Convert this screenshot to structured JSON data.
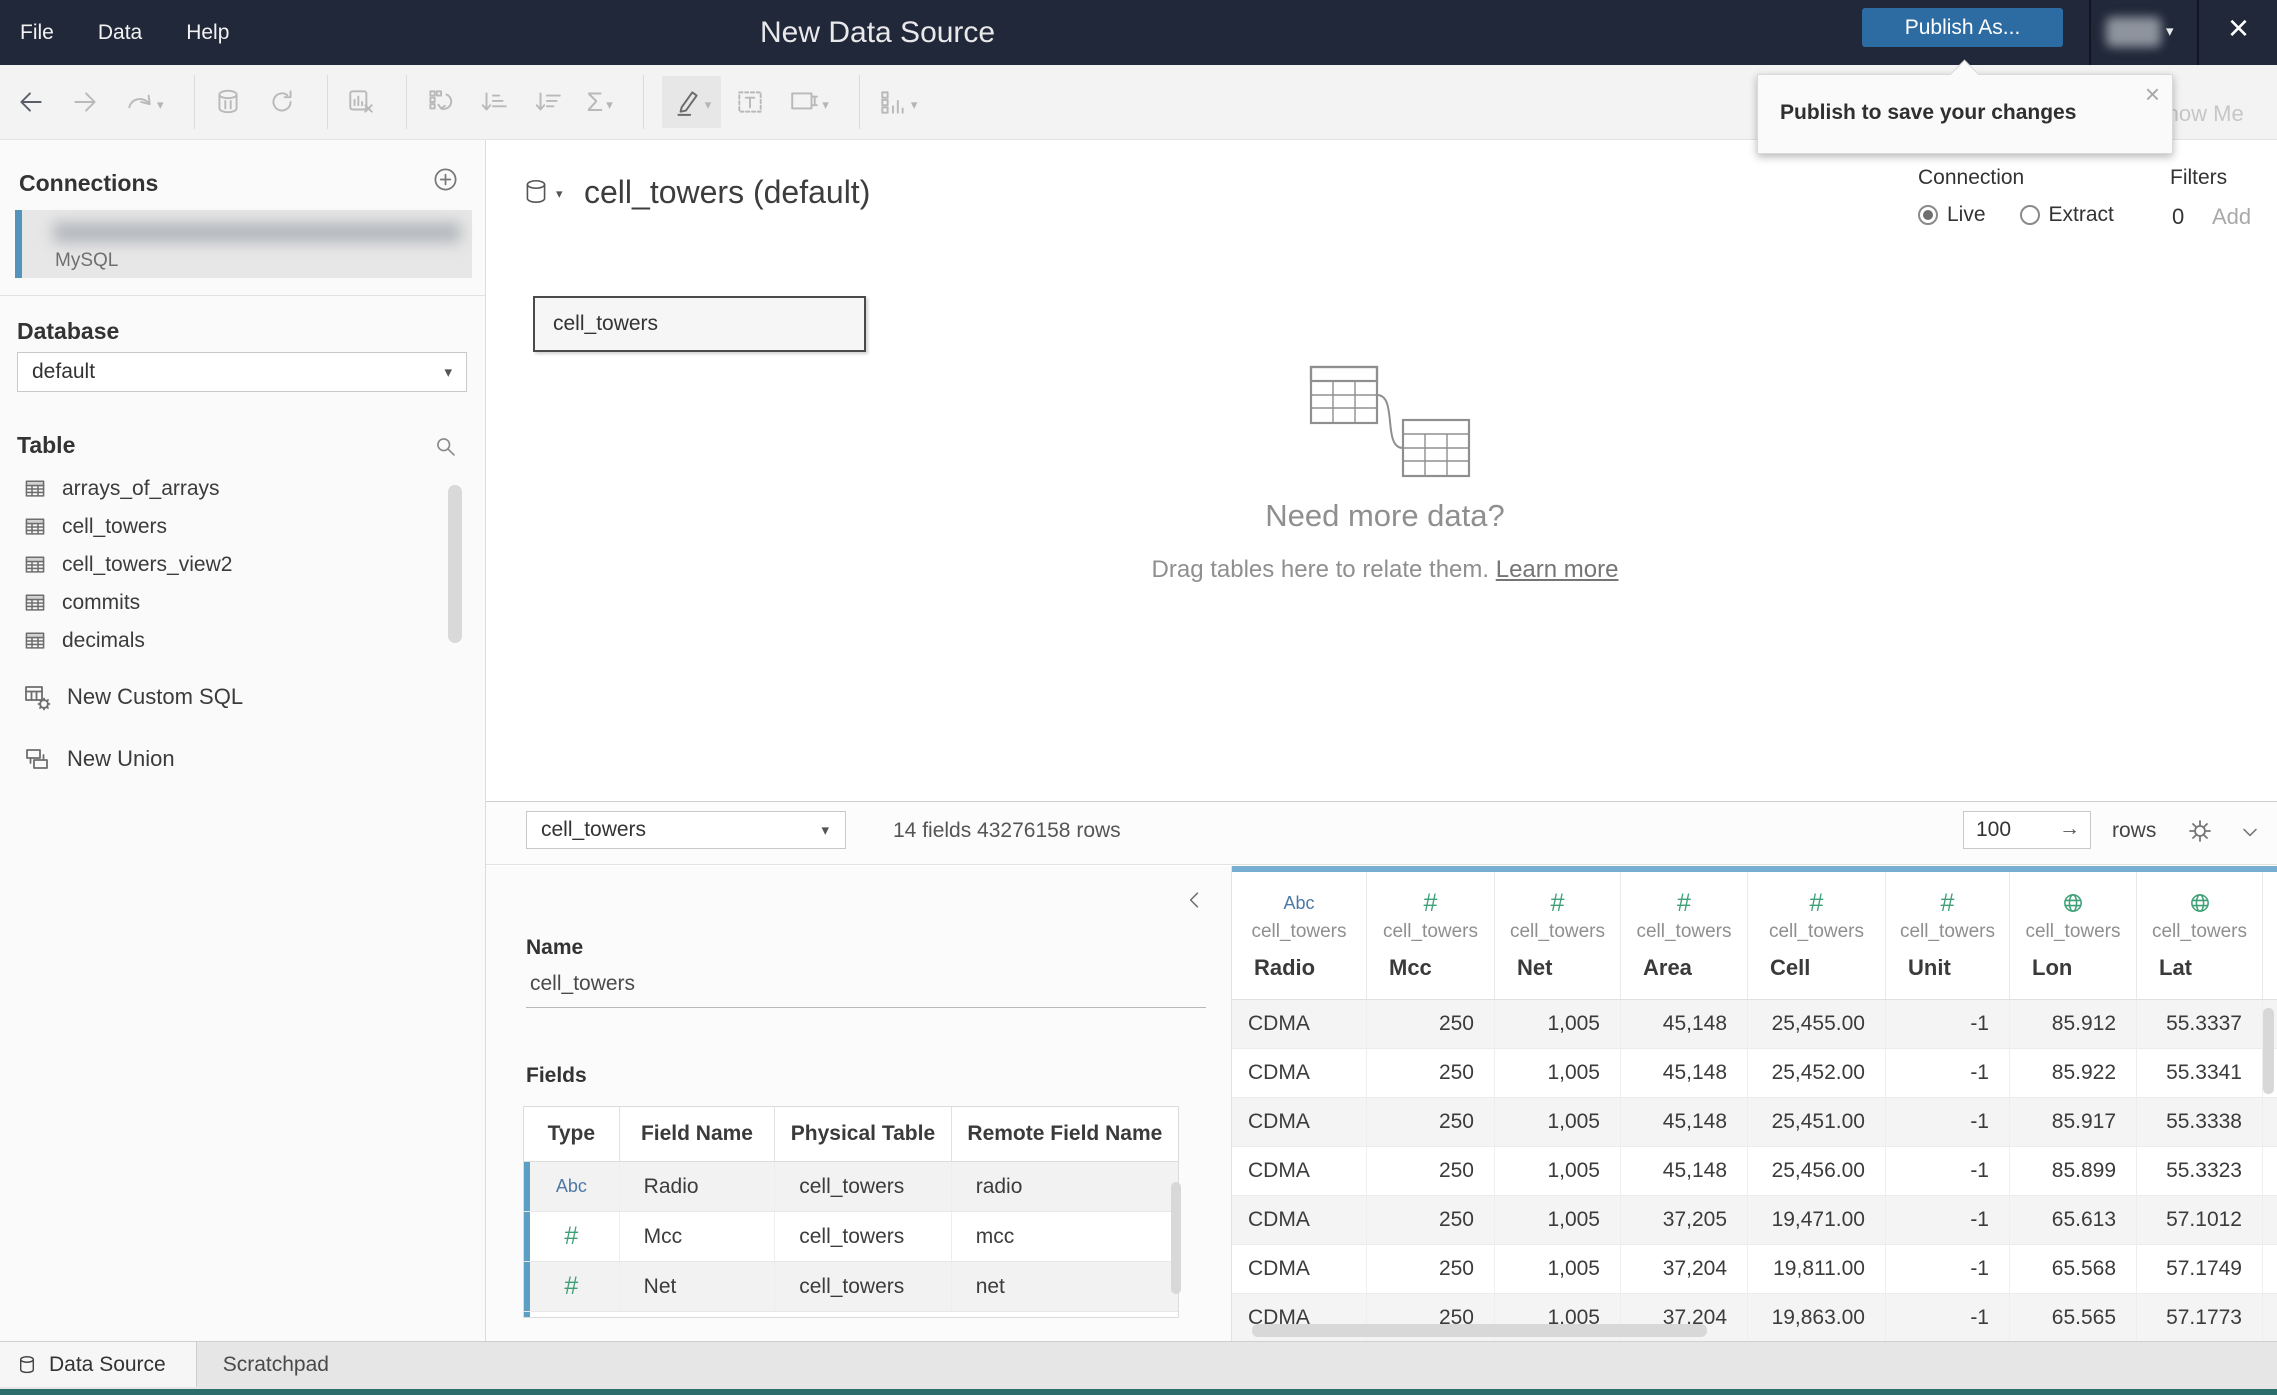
{
  "topbar": {
    "title": "New Data Source",
    "menus": [
      "File",
      "Data",
      "Help"
    ],
    "publish_button": "Publish As...",
    "show_me": "Show Me"
  },
  "tooltip": {
    "text": "Publish to save your changes"
  },
  "toolbar": {
    "groups": [
      [
        {
          "name": "back-icon",
          "tone": "dark"
        },
        {
          "name": "forward-icon",
          "tone": "dim"
        },
        {
          "name": "redo-icon",
          "tone": "dim",
          "caret": true
        }
      ],
      [
        {
          "name": "pause-updates-icon",
          "tone": "dim"
        },
        {
          "name": "refresh-data-source-icon",
          "tone": "dim"
        }
      ],
      [
        {
          "name": "clear-sheet-icon",
          "tone": "dim"
        }
      ],
      [
        {
          "name": "swap-rows-columns-icon",
          "tone": "dim"
        },
        {
          "name": "sort-ascending-icon",
          "tone": "dim"
        },
        {
          "name": "sort-descending-icon",
          "tone": "dim"
        },
        {
          "name": "totals-icon",
          "tone": "dim",
          "caret": true,
          "glyph": "Σ"
        }
      ],
      [
        {
          "name": "highlight-icon",
          "tone": "dark",
          "active": true,
          "caret": true
        },
        {
          "name": "text-label-icon",
          "tone": "dim"
        },
        {
          "name": "fit-icon",
          "tone": "dim",
          "caret": true
        }
      ],
      [
        {
          "name": "show-mark-labels-icon",
          "tone": "dim",
          "caret": true
        }
      ]
    ]
  },
  "sidebar": {
    "connections_title": "Connections",
    "connection": {
      "name_redacted": true,
      "type": "MySQL"
    },
    "database_label": "Database",
    "database_value": "default",
    "table_label": "Table",
    "tables": [
      "arrays_of_arrays",
      "cell_towers",
      "cell_towers_view2",
      "commits",
      "decimals"
    ],
    "actions": [
      {
        "label": "New Custom SQL",
        "icon": "custom-sql-icon"
      },
      {
        "label": "New Union",
        "icon": "union-icon"
      }
    ]
  },
  "canvas": {
    "datasource_title": "cell_towers (default)",
    "connection_label": "Connection",
    "connection_options": [
      {
        "label": "Live",
        "selected": true
      },
      {
        "label": "Extract",
        "selected": false
      }
    ],
    "filters_label": "Filters",
    "filters_count": "0",
    "filters_add": "Add",
    "table_node": "cell_towers",
    "empty_title": "Need more data?",
    "empty_body": "Drag tables here to relate them.",
    "empty_link": "Learn more"
  },
  "preview": {
    "table_selector": "cell_towers",
    "summary": "14 fields 43276158 rows",
    "row_count": "100",
    "rows_label": "rows"
  },
  "metadata": {
    "name_label": "Name",
    "name_value": "cell_towers",
    "fields_label": "Fields",
    "columns": [
      "Type",
      "Field Name",
      "Physical Table",
      "Remote Field Name"
    ],
    "fields": [
      {
        "type": "string",
        "field_name": "Radio",
        "physical_table": "cell_towers",
        "remote_field_name": "radio"
      },
      {
        "type": "number",
        "field_name": "Mcc",
        "physical_table": "cell_towers",
        "remote_field_name": "mcc"
      },
      {
        "type": "number",
        "field_name": "Net",
        "physical_table": "cell_towers",
        "remote_field_name": "net"
      }
    ]
  },
  "grid": {
    "columns": [
      {
        "name": "Radio",
        "table": "cell_towers",
        "type": "string"
      },
      {
        "name": "Mcc",
        "table": "cell_towers",
        "type": "number"
      },
      {
        "name": "Net",
        "table": "cell_towers",
        "type": "number"
      },
      {
        "name": "Area",
        "table": "cell_towers",
        "type": "number"
      },
      {
        "name": "Cell",
        "table": "cell_towers",
        "type": "number"
      },
      {
        "name": "Unit",
        "table": "cell_towers",
        "type": "number"
      },
      {
        "name": "Lon",
        "table": "cell_towers",
        "type": "geographic"
      },
      {
        "name": "Lat",
        "table": "cell_towers",
        "type": "geographic"
      }
    ],
    "rows": [
      [
        "CDMA",
        "250",
        "1,005",
        "45,148",
        "25,455.00",
        "-1",
        "85.912",
        "55.3337"
      ],
      [
        "CDMA",
        "250",
        "1,005",
        "45,148",
        "25,452.00",
        "-1",
        "85.922",
        "55.3341"
      ],
      [
        "CDMA",
        "250",
        "1,005",
        "45,148",
        "25,451.00",
        "-1",
        "85.917",
        "55.3338"
      ],
      [
        "CDMA",
        "250",
        "1,005",
        "45,148",
        "25,456.00",
        "-1",
        "85.899",
        "55.3323"
      ],
      [
        "CDMA",
        "250",
        "1,005",
        "37,205",
        "19,471.00",
        "-1",
        "65.613",
        "57.1012"
      ],
      [
        "CDMA",
        "250",
        "1,005",
        "37,204",
        "19,811.00",
        "-1",
        "65.568",
        "57.1749"
      ],
      [
        "CDMA",
        "250",
        "1,005",
        "37,204",
        "19,863.00",
        "-1",
        "65.565",
        "57.1773"
      ]
    ]
  },
  "footer": {
    "tabs": [
      {
        "label": "Data Source",
        "active": true,
        "icon": "datasource-cylinder-icon"
      },
      {
        "label": "Scratchpad",
        "active": false
      }
    ]
  },
  "colors": {
    "topbar": "#212839",
    "publish_blue": "#2d6ca2",
    "steel_blue": "#5b9fc4",
    "header_strip_blue": "#79aed3",
    "type_string_blue": "#4e79a7",
    "type_number_green": "#3fa077",
    "bottom_strip_teal": "#2b6e6b"
  }
}
